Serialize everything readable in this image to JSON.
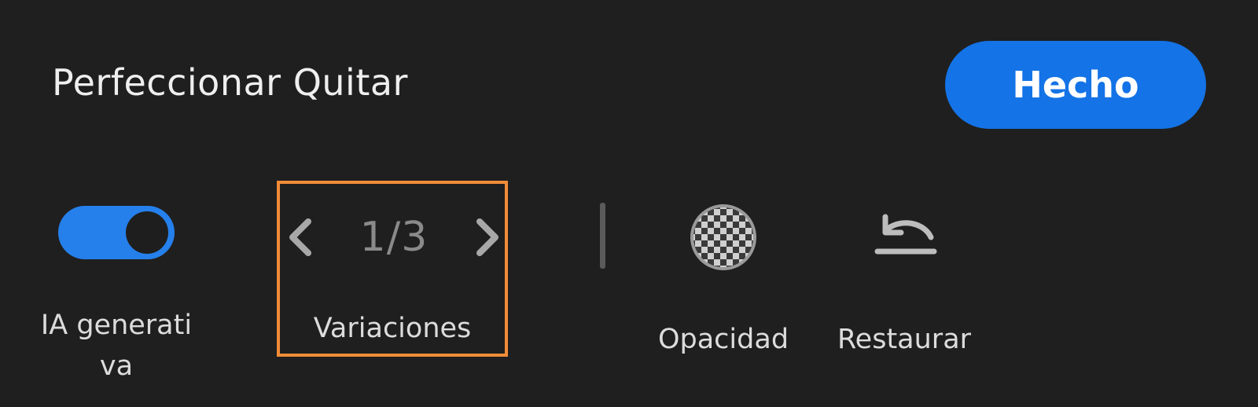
{
  "header": {
    "title": "Perfeccionar Quitar",
    "done_label": "Hecho"
  },
  "toolbar": {
    "generative_ai": {
      "label": "IA generati va",
      "enabled": true,
      "icon": "toggle-switch"
    },
    "variations": {
      "label": "Variaciones",
      "counter": "1/3",
      "prev_icon": "chevron-left-icon",
      "next_icon": "chevron-right-icon",
      "highlight_color": "#f28c38"
    },
    "opacity": {
      "label": "Opacidad",
      "icon": "checkerboard-icon"
    },
    "restore": {
      "label": "Restaurar",
      "icon": "undo-restore-icon"
    }
  },
  "colors": {
    "background": "#1f1f1f",
    "accent": "#1473e6",
    "toggle_on": "#2680eb"
  }
}
